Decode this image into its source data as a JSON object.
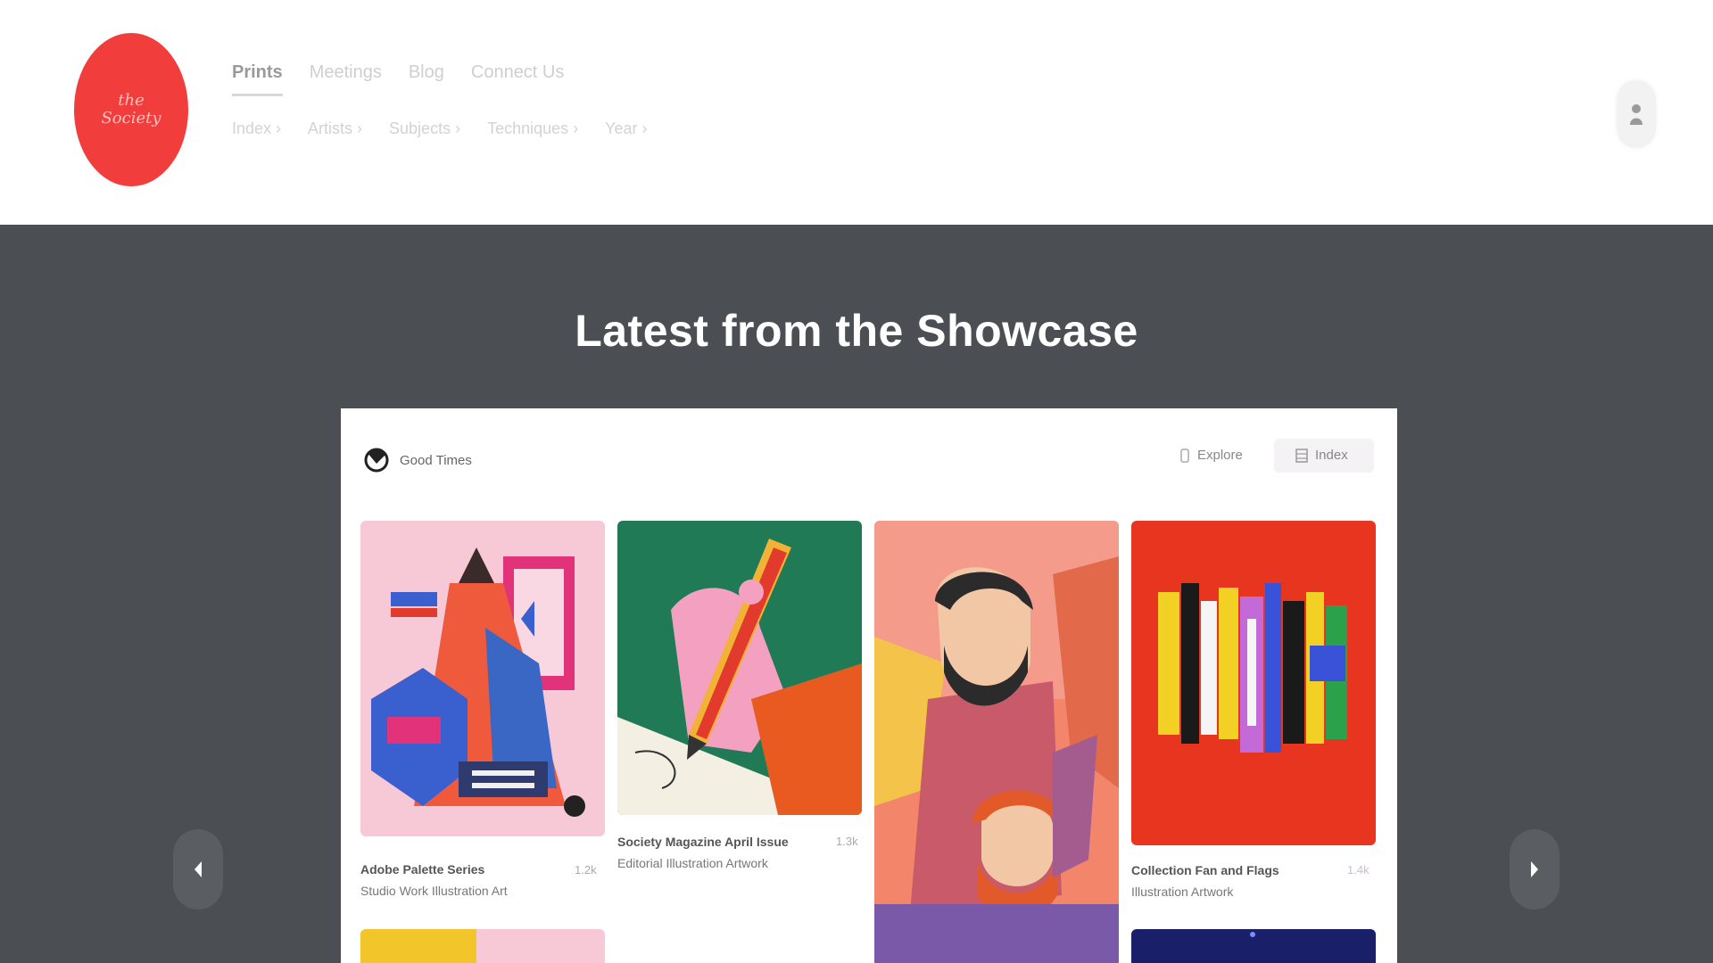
{
  "header": {
    "logo_text": "the\nSociety",
    "nav_primary": [
      "Prints",
      "Meetings",
      "Blog",
      "Connect Us"
    ],
    "nav_secondary": [
      "Index ›",
      "Artists ›",
      "Subjects ›",
      "Techniques ›",
      "Year ›"
    ]
  },
  "showcase": {
    "title": "Latest from the Showcase",
    "brand_name": "Good Times",
    "explore_label": "Explore",
    "index_label": "Index",
    "cards": [
      {
        "title": "Adobe Palette Series",
        "subtitle": "Studio Work Illustration Art",
        "count": "1.2k"
      },
      {
        "title": "Society Magazine April Issue",
        "subtitle": "Editorial Illustration Artwork",
        "count": "1.3k"
      },
      {
        "title": "",
        "subtitle": "",
        "count": ""
      },
      {
        "title": "Collection Fan and Flags",
        "subtitle": "Illustration Artwork",
        "count": "1.4k"
      }
    ]
  },
  "colors": {
    "brand_red": "#f23d3d",
    "band_gray": "#4b4f54",
    "panel_white": "#ffffff"
  },
  "icons": {
    "user": "user-icon",
    "prev": "chevron-left-icon",
    "next": "chevron-right-icon",
    "explore": "explore-icon",
    "index": "grid-icon"
  }
}
